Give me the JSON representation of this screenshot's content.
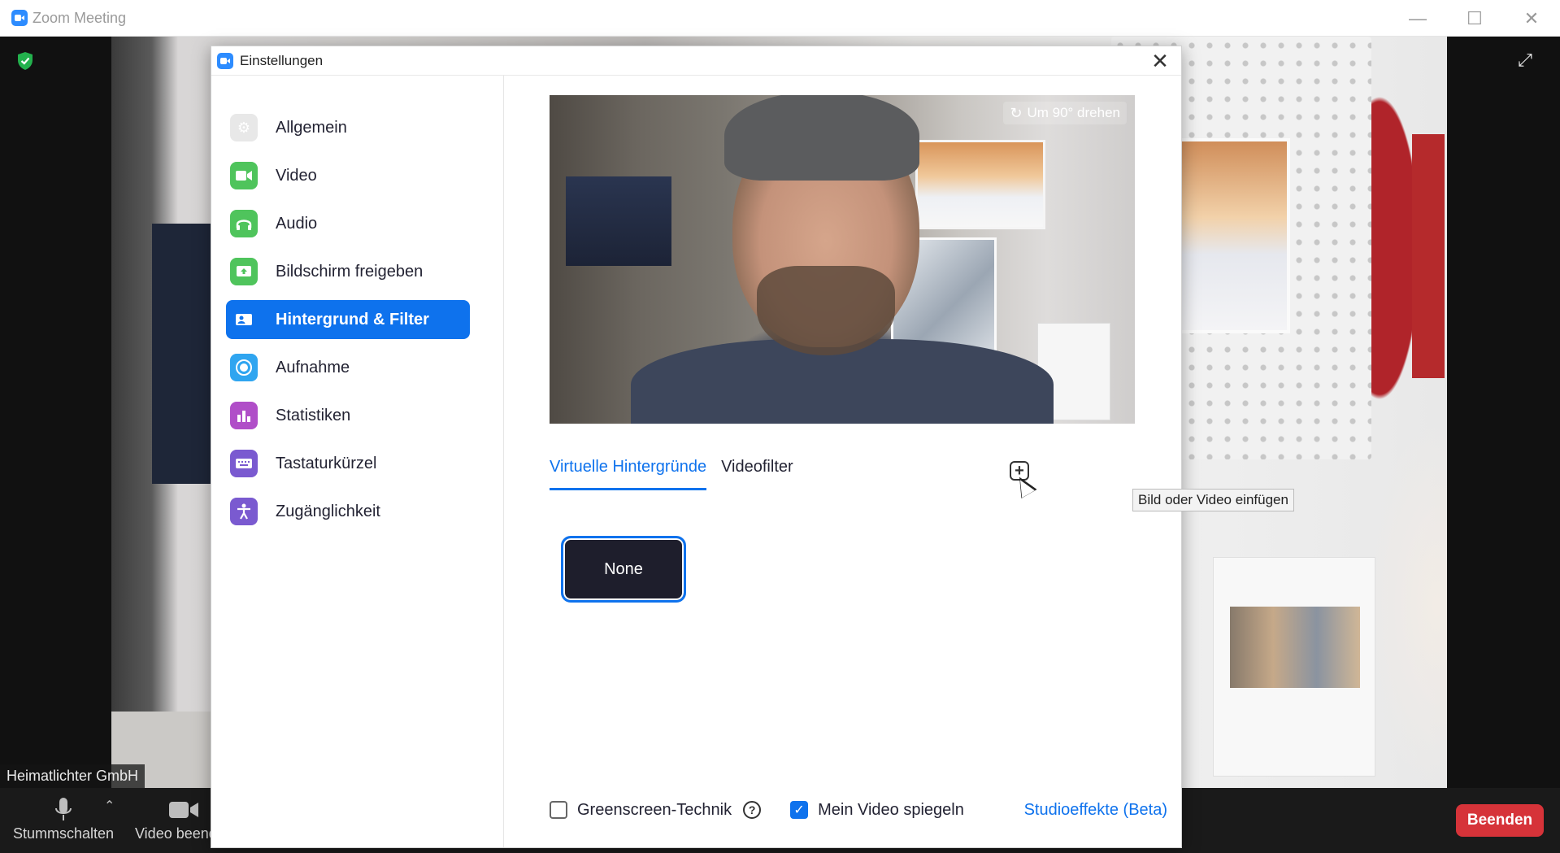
{
  "window": {
    "title": "Zoom Meeting",
    "controls": [
      "—",
      "☐",
      "✕"
    ]
  },
  "meeting": {
    "participant_name": "Heimatlichter GmbH",
    "toolbar": {
      "mute_label": "Stummschalten",
      "video_label": "Video beenden",
      "end_label": "Beenden"
    }
  },
  "settings": {
    "title": "Einstellungen",
    "sidebar": {
      "items": [
        {
          "label": "Allgemein",
          "icon": "gear-icon",
          "color": "#e8e8e8"
        },
        {
          "label": "Video",
          "icon": "video-camera-icon",
          "color": "#4fc45c"
        },
        {
          "label": "Audio",
          "icon": "headphones-icon",
          "color": "#4fc45c"
        },
        {
          "label": "Bildschirm freigeben",
          "icon": "share-screen-icon",
          "color": "#4fc45c"
        },
        {
          "label": "Hintergrund & Filter",
          "icon": "background-icon",
          "color": "#0e72ed",
          "active": true
        },
        {
          "label": "Aufnahme",
          "icon": "record-icon",
          "color": "#2fa5f0"
        },
        {
          "label": "Statistiken",
          "icon": "statistics-icon",
          "color": "#b04ec8"
        },
        {
          "label": "Tastaturkürzel",
          "icon": "keyboard-icon",
          "color": "#7a5ad0"
        },
        {
          "label": "Zugänglichkeit",
          "icon": "accessibility-icon",
          "color": "#7a5ad0"
        }
      ]
    },
    "preview": {
      "rotate_label": "Um 90° drehen"
    },
    "tabs": [
      {
        "label": "Virtuelle Hintergründe",
        "active": true
      },
      {
        "label": "Videofilter",
        "active": false
      }
    ],
    "add_tooltip": "Bild oder Video einfügen",
    "backgrounds": [
      {
        "label": "None",
        "selected": true
      }
    ],
    "options": {
      "greenscreen_label": "Greenscreen-Technik",
      "greenscreen_checked": false,
      "mirror_label": "Mein Video spiegeln",
      "mirror_checked": true,
      "studio_effects_label": "Studioeffekte (Beta)"
    }
  }
}
